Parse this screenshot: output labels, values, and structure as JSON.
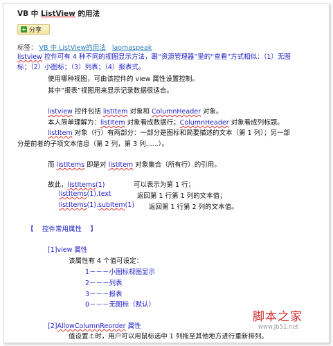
{
  "article": {
    "title_prefix": "VB 中 ",
    "title_underlined": "ListView",
    "title_suffix": " 的用法",
    "share_label": "分享",
    "tags_label": "标签：",
    "tags": [
      "VB 中 ListView的用法",
      "laomaspeak"
    ]
  },
  "body": {
    "l1_a": "listview",
    "l1_b": " 控件可有 4 种不同的视图显示方法，跟“资源管理器”里的“查看”方式相似：（1）无图",
    "l2": "标；（2）小图标；（3）列表；（4）报表式。",
    "l3": "使用哪种视图，可由该控件的 view 属性设置控制。",
    "l4": "其中“报表”视图用来显示记录数据很适合。",
    "l5_a": "listview",
    "l5_b": " 控件包括 ",
    "l5_c": "listItem",
    "l5_d": " 对象和 ",
    "l5_e": "ColumnHeader",
    "l5_f": " 对象。",
    "l6_a": "本人简单理解为：",
    "l6_b": "listItem",
    "l6_c": " 对象看成数据行；",
    "l6_d": "ColumnHeader",
    "l6_e": " 对象看成列标题。",
    "l7_a": "listItem",
    "l7_b": " 对象（行）有两部分：一部分是图标和简要描述的文本（第 1 列）；另一部",
    "l8": "分是前者的子项文本信息（第 2 列，第 3 列......）。",
    "l9_a": "而 ",
    "l9_b": "listItems",
    "l9_c": " 即是对 ",
    "l9_d": "listItem",
    "l9_e": " 对象集合（所有行）的引用。",
    "l10_a": "故此，",
    "l10_b": "listItems",
    "l10_c": "(1)",
    "l10_d": "可以表示为第 1 行；",
    "l11_a": "listItems",
    "l11_b": "(1).text",
    "l11_c": "返回第 1 行第 1 列的文本值；",
    "l12_a": "listItems",
    "l12_b": "(1).",
    "l12_c": "subItem",
    "l12_d": "(1)",
    "l12_e": "返回第 1 行第 2 列的文本值。",
    "h1": "【　 控件常用属性　 】",
    "s1": "[1]view 属性",
    "s1_a": "该属性有 4 个值可设定：",
    "o1": "1－－－小图标视图显示",
    "o2": "2－－－列表",
    "o3": "3－－－报表",
    "o4": "0－－－无图标（默认）",
    "s2_a": "[2]",
    "s2_b": "AllowColumnReorder",
    "s2_c": " 属性",
    "s2_d": "值设置.t.时，用户可以用鼠标选中 1 列拖至其他地方进行重新排列。"
  },
  "watermark": {
    "main": "脚本之家",
    "sub": "www.jb51.net"
  }
}
